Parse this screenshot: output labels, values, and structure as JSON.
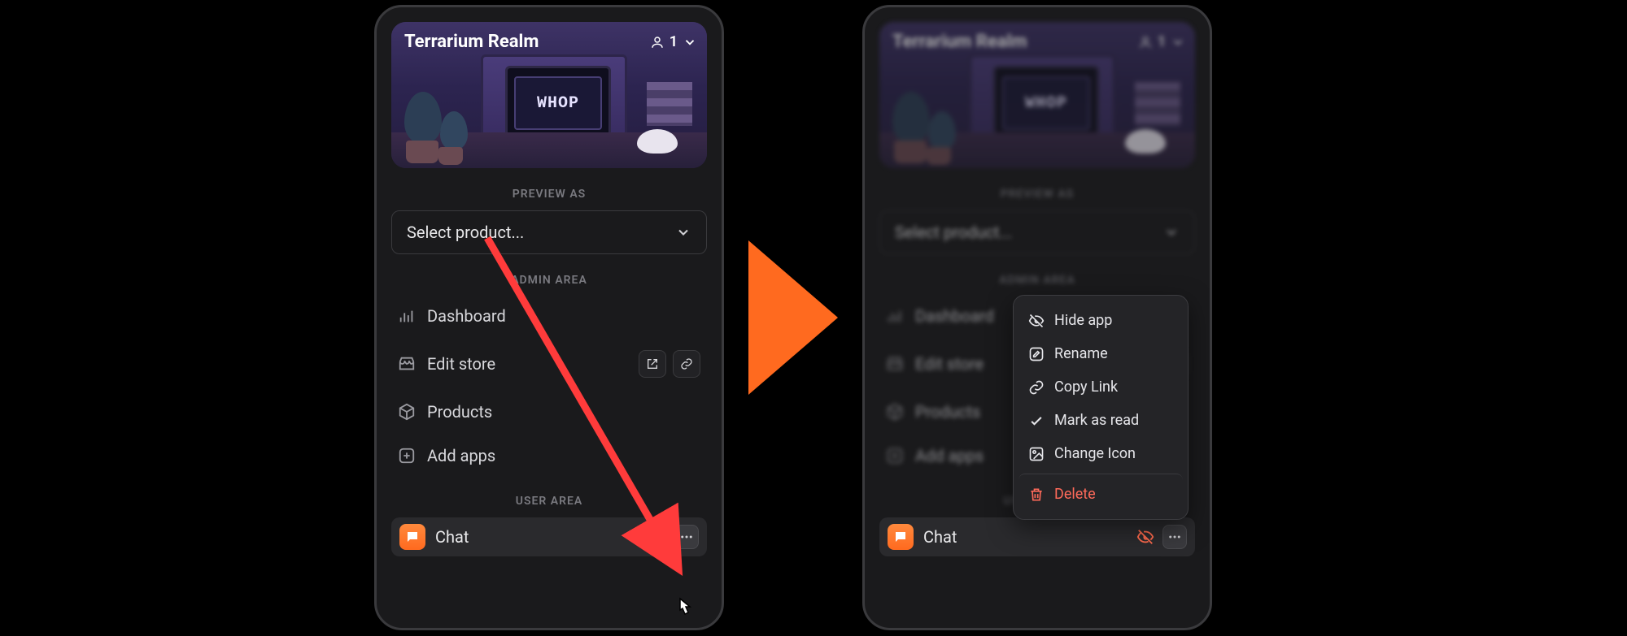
{
  "brand_text": "WHOP",
  "header": {
    "title": "Terrarium Realm",
    "member_count": "1"
  },
  "preview": {
    "section_label": "PREVIEW AS",
    "select_placeholder": "Select product..."
  },
  "admin": {
    "section_label": "ADMIN AREA",
    "items": {
      "dashboard": "Dashboard",
      "edit_store": "Edit store",
      "products": "Products",
      "add_apps": "Add apps"
    }
  },
  "user": {
    "section_label": "USER AREA",
    "chat_label": "Chat"
  },
  "context_menu": {
    "hide_app": "Hide app",
    "rename": "Rename",
    "copy_link": "Copy Link",
    "mark_read": "Mark as read",
    "change_icon": "Change Icon",
    "delete": "Delete"
  },
  "colors": {
    "accent_orange": "#ff6a1f",
    "danger": "#ff6a5a",
    "hidden_eye": "#ff6a4d"
  }
}
